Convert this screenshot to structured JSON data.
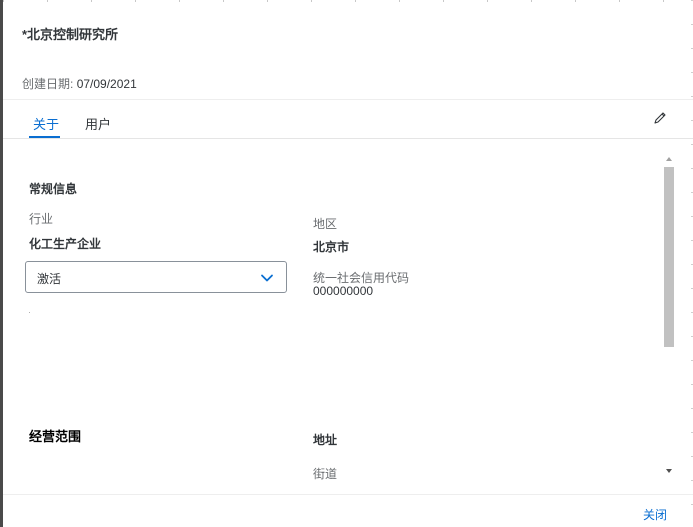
{
  "header": {
    "title": "*北京控制研究所",
    "created_label": "创建日期:",
    "created_value": "07/09/2021"
  },
  "tabs": [
    {
      "label": "关于",
      "selected": true
    },
    {
      "label": "用户",
      "selected": false
    }
  ],
  "general": {
    "section_title": "常规信息",
    "industry_label": "行业",
    "industry_value": "化工生产企业",
    "status_select": {
      "value": "激活"
    },
    "region_label": "地区",
    "region_value": "北京市",
    "credit_code_label": "统一社会信用代码",
    "credit_code_value": "000000000"
  },
  "scope": {
    "section_title": "经营范围"
  },
  "address": {
    "section_title": "地址",
    "street_label": "街道"
  },
  "footer": {
    "close_label": "关闭"
  },
  "icons": {
    "edit": "pencil-icon",
    "select_arrow": "chevron-down-icon"
  },
  "colors": {
    "accent": "#0a6ed1",
    "text": "#32363a",
    "label": "#6a6d70"
  }
}
